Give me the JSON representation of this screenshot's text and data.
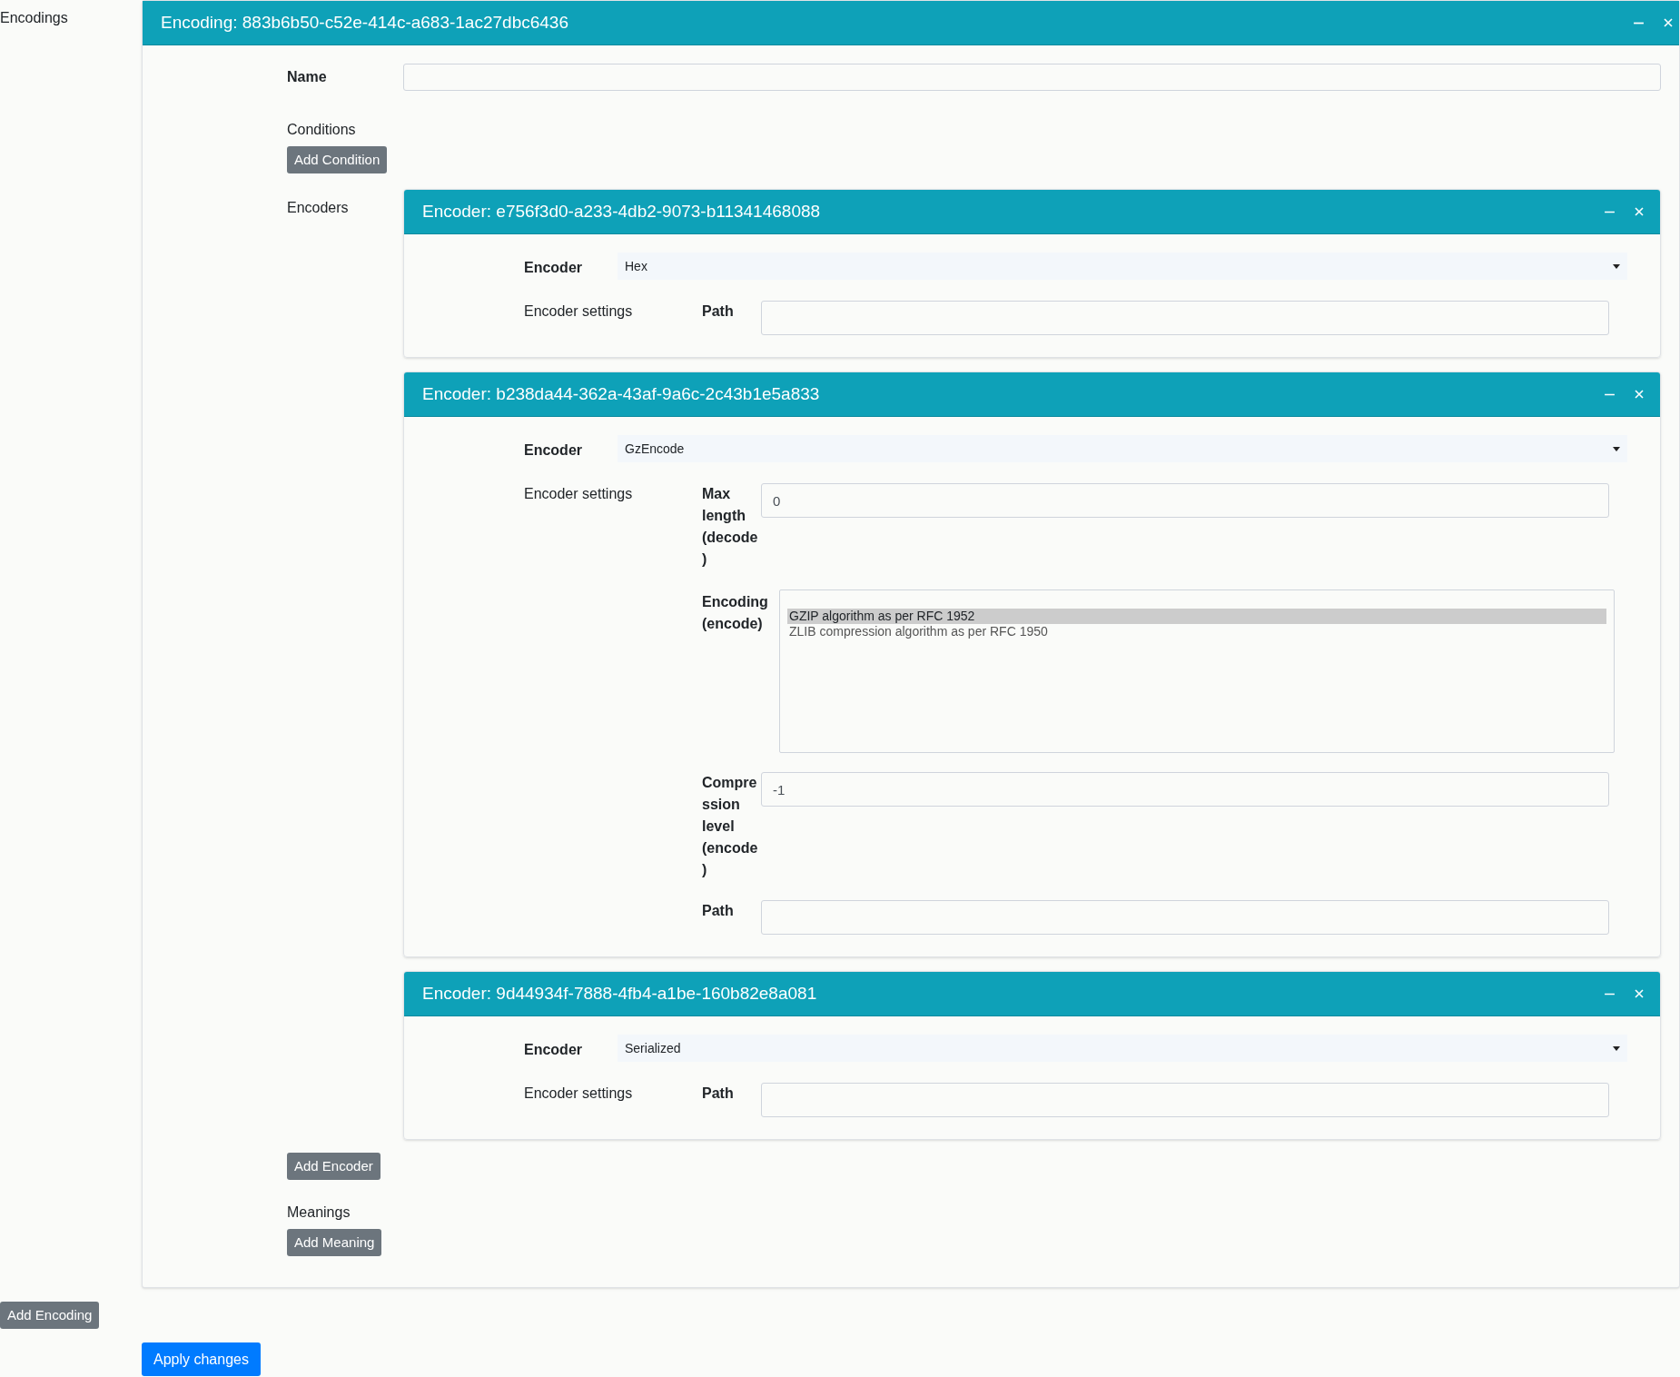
{
  "sidebar_title": "Encodings",
  "encoding": {
    "title": "Encoding: 883b6b50-c52e-414c-a683-1ac27dbc6436",
    "name_label": "Name",
    "conditions_label": "Conditions",
    "add_condition": "Add Condition",
    "encoders_label": "Encoders",
    "encoders": [
      {
        "title": "Encoder: e756f3d0-a233-4db2-9073-b11341468088",
        "encoder_label": "Encoder",
        "encoder_value": "Hex",
        "settings_label": "Encoder settings",
        "settings": [
          {
            "kind": "input",
            "label": "Path"
          }
        ]
      },
      {
        "title": "Encoder: b238da44-362a-43af-9a6c-2c43b1e5a833",
        "encoder_label": "Encoder",
        "encoder_value": "GzEncode",
        "settings_label": "Encoder settings",
        "settings": [
          {
            "kind": "input",
            "label": "Max length (decode)",
            "value": "0"
          },
          {
            "kind": "listbox",
            "label": "Encoding (encode)",
            "options": [
              {
                "label": "GZIP algorithm as per RFC 1952",
                "selected": true
              },
              {
                "label": "ZLIB compression algorithm as per RFC 1950",
                "selected": false
              }
            ]
          },
          {
            "kind": "input",
            "label": "Compression level (encode)",
            "value": "-1"
          },
          {
            "kind": "input",
            "label": "Path"
          }
        ]
      },
      {
        "title": "Encoder: 9d44934f-7888-4fb4-a1be-160b82e8a081",
        "encoder_label": "Encoder",
        "encoder_value": "Serialized",
        "settings_label": "Encoder settings",
        "settings": [
          {
            "kind": "input",
            "label": "Path"
          }
        ]
      }
    ],
    "add_encoder": "Add Encoder",
    "meanings_label": "Meanings",
    "add_meaning": "Add Meaning"
  },
  "add_encoding": "Add Encoding",
  "apply": "Apply changes"
}
